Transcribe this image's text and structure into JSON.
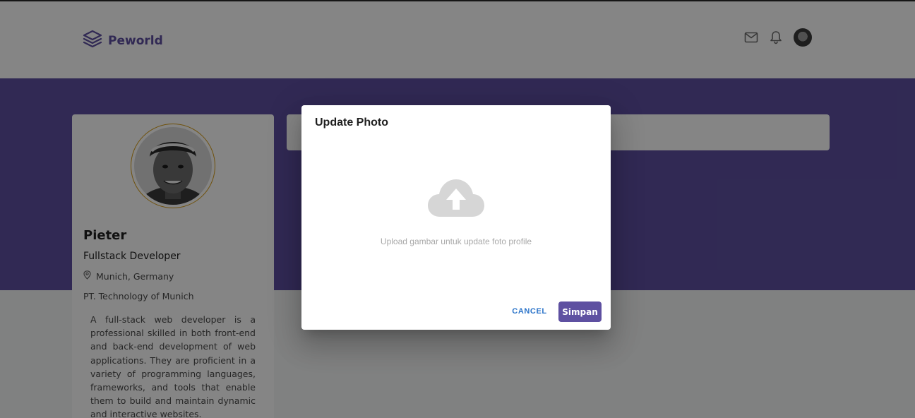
{
  "header": {
    "brand": "Peworld",
    "icons": [
      "mail-icon",
      "bell-icon"
    ]
  },
  "profile": {
    "name": "Pieter",
    "role": "Fullstack Developer",
    "location": "Munich, Germany",
    "company": "PT. Technology of Munich",
    "bio": "A full-stack web developer is a professional skilled in both front-end and back-end development of web applications. They are proficient in a variety of programming languages, frameworks, and tools that enable them to build and maintain dynamic and interactive websites."
  },
  "modal": {
    "title": "Update Photo",
    "upload_hint": "Upload gambar untuk update foto profile",
    "cancel_label": "CANCEL",
    "save_label": "Simpan",
    "upload_icon": "cloud-upload-icon"
  },
  "colors": {
    "brand": "#5e50a1",
    "banner": "#5e50a1",
    "cancel_text": "#2a73c9",
    "avatar_ring": "#d59c16"
  }
}
